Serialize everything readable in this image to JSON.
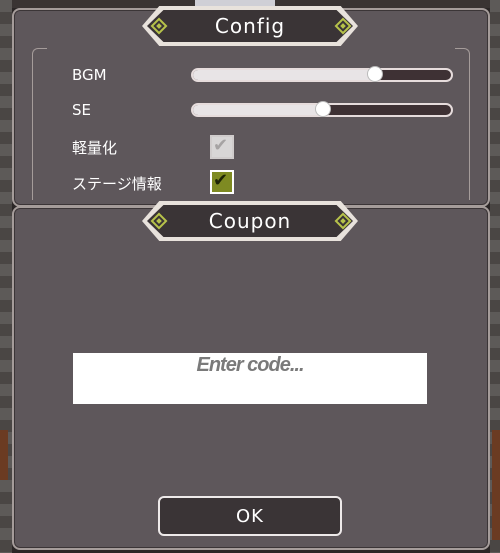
{
  "config": {
    "title": "Config",
    "bgm_label": "BGM",
    "bgm_value": 0.7,
    "se_label": "SE",
    "se_value": 0.5,
    "lightweight_label": "軽量化",
    "lightweight_checked": true,
    "lightweight_enabled": false,
    "stage_info_label": "ステージ情報",
    "stage_info_checked": true
  },
  "coupon": {
    "title": "Coupon",
    "input_placeholder": "Enter code...",
    "input_value": "",
    "ok_label": "OK"
  },
  "colors": {
    "panel": "#5e575b",
    "tab": "#3a3436",
    "accent_green": "#7e8a22",
    "diamond": "#b6c24a"
  },
  "icons": {
    "check": "check-icon",
    "tab_ornament": "diamond-icon"
  }
}
